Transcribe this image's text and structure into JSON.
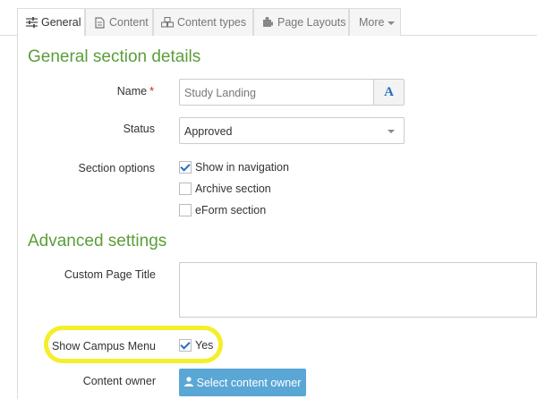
{
  "tabs": [
    {
      "label": "General",
      "icon": "sliders-icon",
      "active": true
    },
    {
      "label": "Content",
      "icon": "document-icon",
      "active": false
    },
    {
      "label": "Content types",
      "icon": "cubes-icon",
      "active": false
    },
    {
      "label": "Page Layouts",
      "icon": "puzzle-icon",
      "active": false
    },
    {
      "label": "More",
      "icon": "chevron-down-icon",
      "active": false
    }
  ],
  "general": {
    "heading": "General section details",
    "name_label": "Name",
    "required_mark": "*",
    "name_value": "Study Landing",
    "font_button": "A",
    "status_label": "Status",
    "status_value": "Approved",
    "section_options_label": "Section options",
    "options": [
      {
        "label": "Show in navigation",
        "checked": true
      },
      {
        "label": "Archive section",
        "checked": false
      },
      {
        "label": "eForm section",
        "checked": false
      }
    ]
  },
  "advanced": {
    "heading": "Advanced settings",
    "custom_title_label": "Custom Page Title",
    "custom_title_value": "",
    "campus_menu_label": "Show Campus Menu",
    "campus_menu_option": "Yes",
    "campus_menu_checked": true,
    "content_owner_label": "Content owner",
    "select_owner_button": "Select content owner"
  },
  "colors": {
    "heading_green": "#5a9e3a",
    "button_blue": "#5aa7d6",
    "highlight_yellow": "#f4ef2a"
  }
}
